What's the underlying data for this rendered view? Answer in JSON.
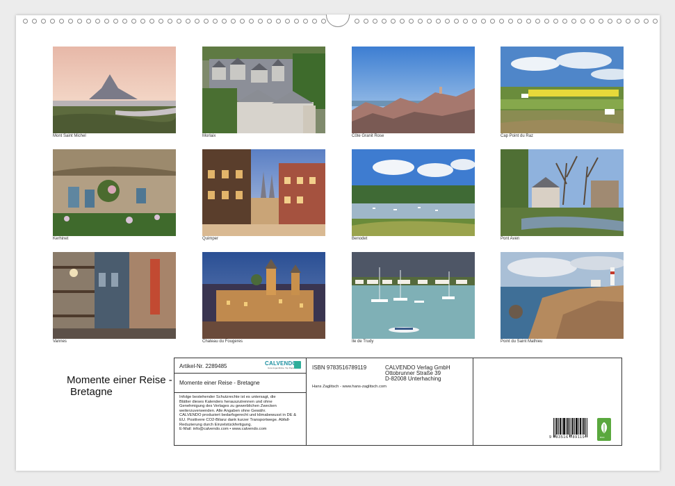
{
  "photos": [
    {
      "caption": "Mont Saint Michel"
    },
    {
      "caption": "Morlaix"
    },
    {
      "caption": "Côte Granit Rose"
    },
    {
      "caption": "Cap Point du Raz"
    },
    {
      "caption": "Kerhinet"
    },
    {
      "caption": "Quimper"
    },
    {
      "caption": "Benodet"
    },
    {
      "caption": "Pont Aven"
    },
    {
      "caption": "Vannes"
    },
    {
      "caption": "Chateau du Fougeres"
    },
    {
      "caption": "Ile de Trudy"
    },
    {
      "caption": "Point du Saint Mathieu"
    }
  ],
  "title": {
    "line1": "Momente einer Reise -",
    "line2": "Bretagne"
  },
  "info": {
    "article_no": "Artikel-Nr. 2289485",
    "logo_name": "CALVENDO",
    "logo_sub": "Gute Augenblicke, Top Papier",
    "calendar_title": "Momente einer Reise - Bretagne",
    "legal_lines": [
      "Infolge bestehender Schutzrechte ist es untersagt, die",
      "Blätter dieses Kalenders herauszutrennen und ohne",
      "Genehmigung des Verlages zu gewerblichen Zwecken",
      "weiterzuverwenden. Alle Angaben ohne Gewähr.",
      "CALVENDO produziert bedarfsgerecht und klimabewusst in DE &",
      "EU. Positivere CO2-Bilanz dank kurzer Transportwege. Abfall-",
      "Reduzierung durch Einzelstückfertigung.",
      "E-Mail: info@calvendo.com • www.calvendo.com"
    ],
    "isbn": "ISBN 9783516789119",
    "publisher_lines": [
      "CALVENDO Verlag GmbH",
      "Ottobrunner Straße 39",
      "D-82008 Unterhaching"
    ],
    "author": "Hans Zaglitsch - www.hans-zaglitsch.com",
    "barcode_number": "9  783516  789119",
    "eco_label": "eco"
  },
  "colors": {
    "accent": "#1b8fa0",
    "eco_green": "#5aa83e"
  }
}
